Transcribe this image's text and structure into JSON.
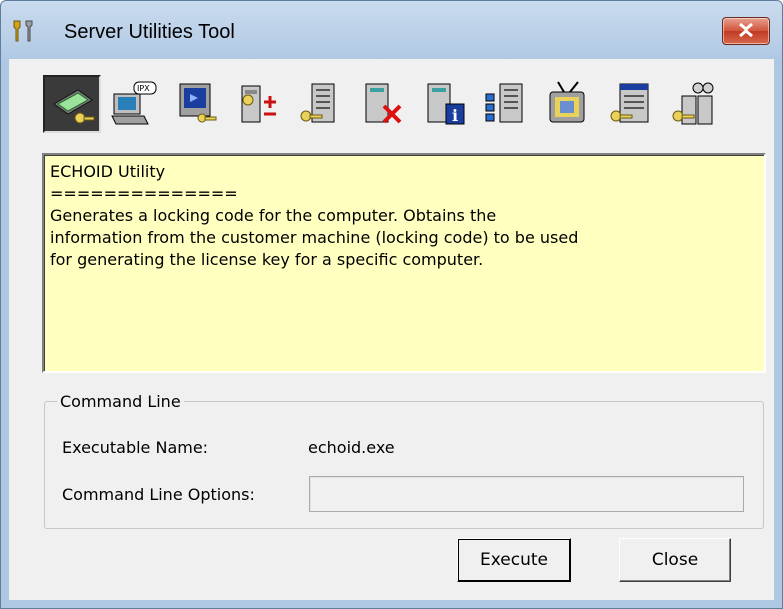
{
  "window": {
    "title": "Server Utilities Tool"
  },
  "toolbar": {
    "tools": [
      {
        "icon": "network-card-key-icon",
        "active": true
      },
      {
        "icon": "ipx-computer-icon"
      },
      {
        "icon": "monitor-key-icon"
      },
      {
        "icon": "server-plus-minus-icon"
      },
      {
        "icon": "document-key-icon"
      },
      {
        "icon": "server-delete-icon"
      },
      {
        "icon": "server-info-icon"
      },
      {
        "icon": "document-grid-icon"
      },
      {
        "icon": "monitor-antenna-icon"
      },
      {
        "icon": "window-key-icon"
      },
      {
        "icon": "servers-key-icon"
      }
    ]
  },
  "info": {
    "lines": [
      "ECHOID Utility",
      "==============",
      "Generates a locking code for the computer. Obtains the",
      "information from the customer machine (locking code) to be used",
      "for generating the license key for a specific computer."
    ]
  },
  "command_line": {
    "group_label": "Command Line",
    "executable_label": "Executable Name:",
    "executable_value": "echoid.exe",
    "options_label": "Command Line Options:",
    "options_value": ""
  },
  "buttons": {
    "execute": "Execute",
    "close": "Close"
  }
}
